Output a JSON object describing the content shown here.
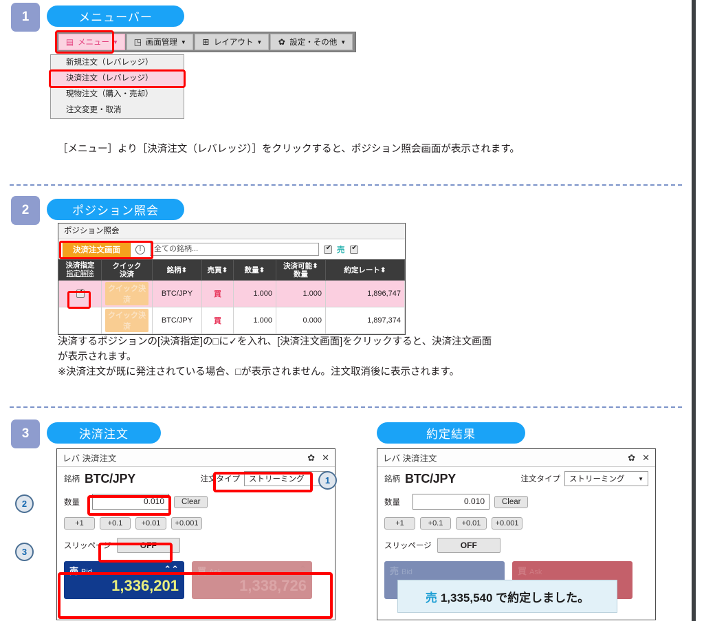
{
  "sections": [
    {
      "number": "1",
      "title": "メニューバー"
    },
    {
      "number": "2",
      "title": "ポジション照会"
    },
    {
      "number": "3",
      "title": "決済注文",
      "title2": "約定結果"
    }
  ],
  "menubar": {
    "items": [
      {
        "icon": "menu-list-icon",
        "glyph": "▤",
        "label": "メニュー",
        "caret": "▼"
      },
      {
        "icon": "screen-manage-icon",
        "glyph": "◳",
        "label": "画面管理",
        "caret": "▼"
      },
      {
        "icon": "layout-icon",
        "glyph": "⊞",
        "label": "レイアウト",
        "caret": "▼"
      },
      {
        "icon": "gear-icon",
        "glyph": "✿",
        "label": "設定・その他",
        "caret": "▼"
      }
    ],
    "dropdown": [
      {
        "label": "新規注文（レバレッジ）",
        "selected": false
      },
      {
        "label": "決済注文（レバレッジ）",
        "selected": true
      },
      {
        "label": "現物注文（購入・売却）",
        "selected": false
      },
      {
        "label": "注文変更・取消",
        "selected": false
      }
    ]
  },
  "paragraphs": {
    "p1": "［メニュー］より［決済注文（レバレッジ）］をクリックすると、ポジション照会画面が表示されます。",
    "p2": "決済するポジションの[決済指定]の□に✓を入れ、[決済注文画面]をクリックすると、決済注文画面\nが表示されます。\n※決済注文が既に発注されている場合、□が表示されません。注文取消後に表示されます。"
  },
  "position_window": {
    "title": "ポジション照会",
    "order_screen_button": "決済注文画面",
    "info_icon": "!",
    "filter_placeholder": "全ての銘柄...",
    "sell_checkbox_label": "売",
    "columns": [
      {
        "line1": "決済指定",
        "line2": "指定解除",
        "sort": false
      },
      {
        "line1": "クイック",
        "line2": "決済",
        "sort": false
      },
      {
        "line1": "銘柄",
        "line2": "",
        "sort": true
      },
      {
        "line1": "売買",
        "line2": "",
        "sort": true
      },
      {
        "line1": "数量",
        "line2": "",
        "sort": true
      },
      {
        "line1": "決済可能",
        "line2": "数量",
        "sort": true
      },
      {
        "line1": "約定レート",
        "line2": "",
        "sort": true
      }
    ],
    "quick_button_label": "クイック決済",
    "rows": [
      {
        "checked": true,
        "highlighted": true,
        "symbol": "BTC/JPY",
        "side": "買",
        "qty": "1.000",
        "closable": "1.000",
        "rate": "1,896,747"
      },
      {
        "checked": false,
        "highlighted": false,
        "symbol": "BTC/JPY",
        "side": "買",
        "qty": "1.000",
        "closable": "0.000",
        "rate": "1,897,374"
      }
    ]
  },
  "order_panel": {
    "window_title": "レバ 決済注文",
    "gear_icon": "✿",
    "close_icon": "✕",
    "symbol_label": "銘柄",
    "symbol_value": "BTC/JPY",
    "order_type_label": "注文タイプ",
    "order_type_value": "ストリーミング",
    "order_type_caret": "▼",
    "qty_label": "数量",
    "qty_value": "0.010",
    "clear_label": "Clear",
    "step_buttons": [
      "+1",
      "+0.1",
      "+0.01",
      "+0.001"
    ],
    "slippage_label": "スリッページ",
    "slippage_value": "OFF",
    "bid": {
      "jp": "売",
      "en": "Bid",
      "value": "1,336,201",
      "arrow": "⌃⌃",
      "color": "#103a8e"
    },
    "ask": {
      "jp": "買",
      "en": "Ask",
      "value": "1,338,726",
      "arrow": "⌃",
      "color": "#cf8e91"
    }
  },
  "callouts": {
    "one": "1",
    "two": "2",
    "three": "3"
  },
  "fill_result": {
    "sell_mark": "売",
    "message": "1,335,540 で約定しました。"
  }
}
